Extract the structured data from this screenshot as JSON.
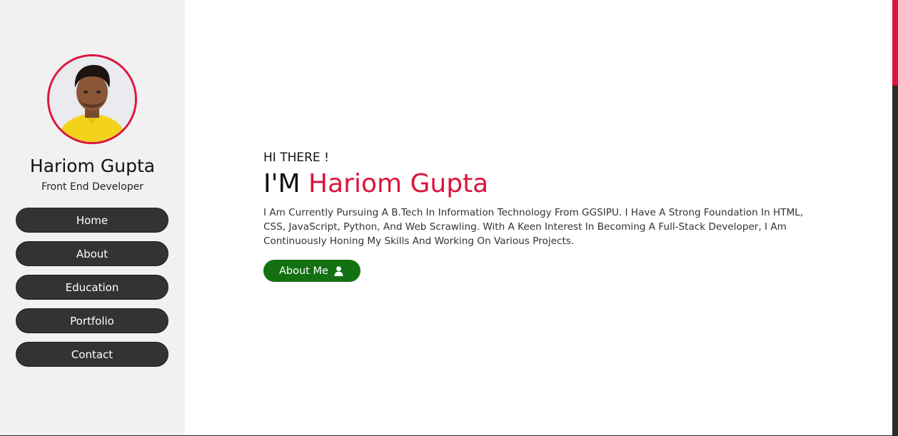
{
  "sidebar": {
    "name": "Hariom Gupta",
    "role": "Front End Developer",
    "nav": [
      {
        "label": "Home"
      },
      {
        "label": "About"
      },
      {
        "label": "Education"
      },
      {
        "label": "Portfolio"
      },
      {
        "label": "Contact"
      }
    ]
  },
  "hero": {
    "greeting": "HI THERE !",
    "prefix": "I'M",
    "name": "Hariom Gupta",
    "bio": "I Am Currently Pursuing A B.Tech In Information Technology From GGSIPU. I Have A Strong Foundation In HTML, CSS, JavaScript, Python, And Web Scrawling. With A Keen Interest In Becoming A Full-Stack Developer, I Am Continuously Honing My Skills And Working On Various Projects.",
    "button_label": "About Me",
    "button_icon": "user-icon"
  },
  "colors": {
    "accent": "#dc143c",
    "button_green": "#147112",
    "nav_bg": "#333333",
    "sidebar_bg": "#f1f1f2"
  }
}
